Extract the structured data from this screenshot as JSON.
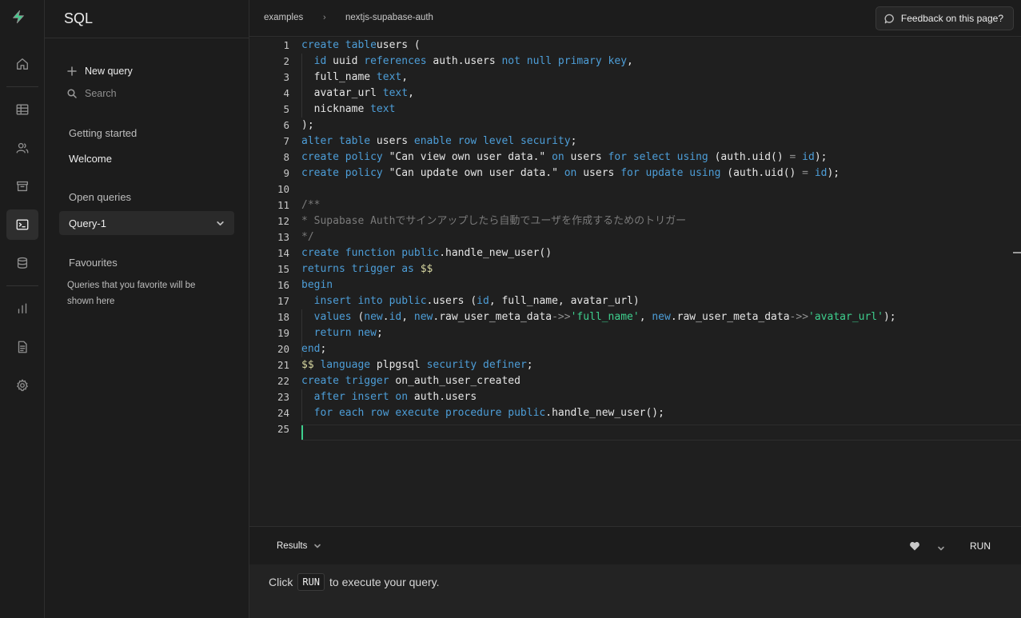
{
  "app": {
    "section_title": "SQL"
  },
  "breadcrumb": [
    "examples",
    "nextjs-supabase-auth"
  ],
  "feedback_label": "Feedback on this page?",
  "sidebar": {
    "new_query": "New query",
    "search_placeholder": "Search",
    "getting_started": "Getting started",
    "welcome": "Welcome",
    "open_queries": "Open queries",
    "query_tab": "Query-1",
    "favourites": "Favourites",
    "favourites_note": "Queries that you favorite will be shown here"
  },
  "editor": {
    "lines": [
      [
        [
          "kw",
          "create table"
        ],
        [
          "",
          "users ("
        ]
      ],
      [
        [
          "",
          "  "
        ],
        [
          "kw",
          "id"
        ],
        [
          "",
          " uuid "
        ],
        [
          "kw",
          "references"
        ],
        [
          "",
          " auth.users "
        ],
        [
          "kw",
          "not null primary key"
        ],
        [
          "",
          ","
        ]
      ],
      [
        [
          "",
          "  full_name "
        ],
        [
          "kw",
          "text"
        ],
        [
          "",
          ","
        ]
      ],
      [
        [
          "",
          "  avatar_url "
        ],
        [
          "kw",
          "text"
        ],
        [
          "",
          ","
        ]
      ],
      [
        [
          "",
          "  nickname "
        ],
        [
          "kw",
          "text"
        ]
      ],
      [
        [
          "",
          ");"
        ]
      ],
      [
        [
          "kw",
          "alter table"
        ],
        [
          "",
          " users "
        ],
        [
          "kw",
          "enable row level security"
        ],
        [
          "",
          ";"
        ]
      ],
      [
        [
          "kw",
          "create policy"
        ],
        [
          "",
          " \"Can view own user data.\" "
        ],
        [
          "kw",
          "on"
        ],
        [
          "",
          " users "
        ],
        [
          "kw",
          "for select using"
        ],
        [
          "",
          " (auth.uid() "
        ],
        [
          "op",
          "="
        ],
        [
          "",
          " "
        ],
        [
          "kw",
          "id"
        ],
        [
          "",
          ");"
        ]
      ],
      [
        [
          "kw",
          "create policy"
        ],
        [
          "",
          " \"Can update own user data.\" "
        ],
        [
          "kw",
          "on"
        ],
        [
          "",
          " users "
        ],
        [
          "kw",
          "for update using"
        ],
        [
          "",
          " (auth.uid() "
        ],
        [
          "op",
          "="
        ],
        [
          "",
          " "
        ],
        [
          "kw",
          "id"
        ],
        [
          "",
          ");"
        ]
      ],
      [],
      [
        [
          "cm",
          "/**"
        ]
      ],
      [
        [
          "cm",
          "* Supabase Authでサインアップしたら自動でユーザを作成するためのトリガー"
        ]
      ],
      [
        [
          "cm",
          "*/"
        ]
      ],
      [
        [
          "kw",
          "create function public"
        ],
        [
          "",
          ".handle_new_user()"
        ]
      ],
      [
        [
          "kw",
          "returns trigger as"
        ],
        [
          "",
          " "
        ],
        [
          "dol",
          "$$"
        ]
      ],
      [
        [
          "kw",
          "begin"
        ]
      ],
      [
        [
          "",
          "  "
        ],
        [
          "kw",
          "insert into public"
        ],
        [
          "",
          ".users ("
        ],
        [
          "kw",
          "id"
        ],
        [
          "",
          ", full_name, avatar_url)"
        ]
      ],
      [
        [
          "",
          "  "
        ],
        [
          "kw",
          "values"
        ],
        [
          "",
          " ("
        ],
        [
          "kw",
          "new"
        ],
        [
          "",
          "."
        ],
        [
          "kw",
          "id"
        ],
        [
          "",
          ", "
        ],
        [
          "kw",
          "new"
        ],
        [
          "",
          ".raw_user_meta_data"
        ],
        [
          "op",
          "->>"
        ],
        [
          "grn",
          "'full_name'"
        ],
        [
          "",
          ", "
        ],
        [
          "kw",
          "new"
        ],
        [
          "",
          ".raw_user_meta_data"
        ],
        [
          "op",
          "->>"
        ],
        [
          "grn",
          "'avatar_url'"
        ],
        [
          "",
          ");"
        ]
      ],
      [
        [
          "",
          "  "
        ],
        [
          "kw",
          "return new"
        ],
        [
          "",
          ";"
        ]
      ],
      [
        [
          "kw",
          "end"
        ],
        [
          "",
          ";"
        ]
      ],
      [
        [
          "dol",
          "$$"
        ],
        [
          "",
          " "
        ],
        [
          "kw",
          "language"
        ],
        [
          "",
          " plpgsql "
        ],
        [
          "kw",
          "security definer"
        ],
        [
          "",
          ";"
        ]
      ],
      [
        [
          "kw",
          "create trigger"
        ],
        [
          "",
          " on_auth_user_created"
        ]
      ],
      [
        [
          "",
          "  "
        ],
        [
          "kw",
          "after insert on"
        ],
        [
          "",
          " auth.users"
        ]
      ],
      [
        [
          "",
          "  "
        ],
        [
          "kw",
          "for each row execute procedure public"
        ],
        [
          "",
          ".handle_new_user();"
        ]
      ],
      []
    ]
  },
  "results": {
    "label": "Results",
    "run_label": "RUN",
    "message_before": "Click",
    "message_chip": "RUN",
    "message_after": "to execute your query."
  },
  "icons": {
    "rail": [
      "home-icon",
      "table-editor-icon",
      "users-icon",
      "archive-icon",
      "sql-terminal-icon",
      "database-icon",
      "reports-icon",
      "docs-icon",
      "settings-icon"
    ]
  },
  "colors": {
    "accent": "#3ecf8e",
    "keyword": "#4d9ed8",
    "background": "#1c1c1c"
  }
}
